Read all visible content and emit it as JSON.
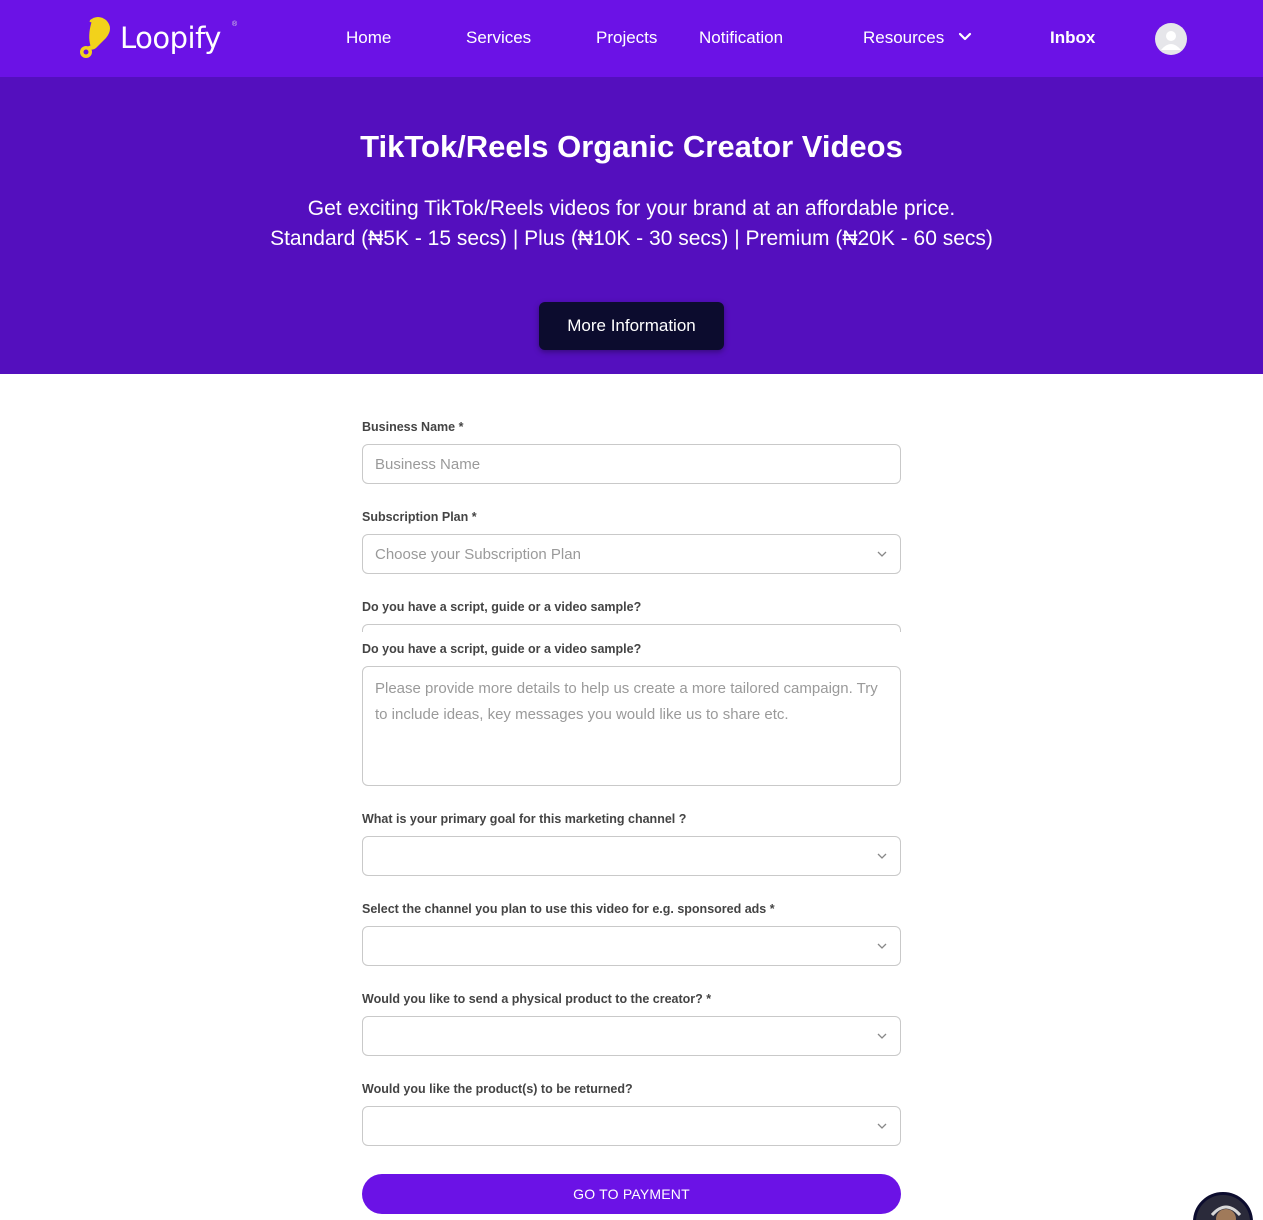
{
  "nav": {
    "brand": "Loopify",
    "brand_mark": "®",
    "links": [
      "Home",
      "Services",
      "Projects",
      "Notification",
      "Resources"
    ],
    "inbox": "Inbox",
    "colors": {
      "background": "#6b12e6",
      "logo_accent": "#f2d21b"
    }
  },
  "hero": {
    "title": "TikTok/Reels Organic Creator Videos",
    "subtitle_line1": "Get exciting TikTok/Reels videos for your brand at an affordable price.",
    "subtitle_line2": "Standard (₦5K - 15 secs) | Plus (₦10K - 30 secs) | Premium (₦20K - 60 secs)",
    "button": "More Information",
    "colors": {
      "background": "#540fbe",
      "button": "#0c0c2e"
    }
  },
  "form": {
    "business_name": {
      "label": "Business Name *",
      "placeholder": "Business Name",
      "value": ""
    },
    "subscription_plan": {
      "label": "Subscription Plan *",
      "placeholder": "Choose your Subscription Plan"
    },
    "script_sample": {
      "label": "Do you have a script, guide or a video sample?"
    },
    "details": {
      "label": "Do you have a script, guide or a video sample?",
      "placeholder": "Please provide more details to help us create a more tailored campaign. Try to include ideas, key messages you would like us to share etc."
    },
    "primary_goal": {
      "label": "What is your primary goal for this marketing channel ?",
      "value": ""
    },
    "channel": {
      "label": "Select the channel you plan to use this video for e.g. sponsored ads *",
      "value": ""
    },
    "physical_product": {
      "label": "Would you like to send a physical product to the creator? *",
      "value": ""
    },
    "product_return": {
      "label": "Would you like the product(s) to be returned?",
      "value": ""
    },
    "submit": "GO TO PAYMENT",
    "submit_color": "#6b12e6"
  }
}
